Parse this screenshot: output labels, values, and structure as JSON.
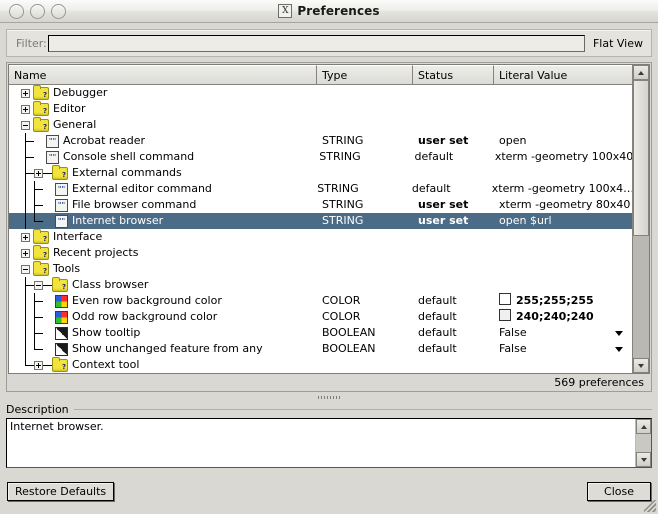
{
  "window": {
    "title": "Preferences",
    "logo_glyph": "X",
    "controls": [
      "close-button",
      "minimize-button",
      "zoom-button"
    ]
  },
  "filter_bar": {
    "label": "Filter:",
    "value": "",
    "placeholder": "",
    "flat_view_label": "Flat View"
  },
  "tree": {
    "columns": [
      "Name",
      "Type",
      "Status",
      "Literal Value"
    ],
    "status_text": "569 preferences",
    "selection_color": "#4b6b86",
    "rows": [
      {
        "name": "Debugger",
        "depth": 0,
        "kind": "folder",
        "expander": "plus",
        "type": "",
        "status": "",
        "literal": "",
        "selected": false
      },
      {
        "name": "Editor",
        "depth": 0,
        "kind": "folder",
        "expander": "plus",
        "type": "",
        "status": "",
        "literal": "",
        "selected": false
      },
      {
        "name": "General",
        "depth": 0,
        "kind": "folder",
        "expander": "minus",
        "type": "",
        "status": "",
        "literal": "",
        "selected": false
      },
      {
        "name": "Acrobat reader",
        "depth": 1,
        "kind": "string",
        "expander": "none",
        "type": "STRING",
        "status": "user set",
        "literal": "open",
        "selected": false
      },
      {
        "name": "Console shell command",
        "depth": 1,
        "kind": "string",
        "expander": "none",
        "type": "STRING",
        "status": "default",
        "literal": "xterm -geometry 100x40",
        "selected": false
      },
      {
        "name": "External commands",
        "depth": 1,
        "kind": "folder",
        "expander": "plus",
        "type": "",
        "status": "",
        "literal": "",
        "selected": false
      },
      {
        "name": "External editor command",
        "depth": 2,
        "kind": "string",
        "expander": "none",
        "type": "STRING",
        "status": "default",
        "literal": "xterm -geometry 100x4…",
        "selected": false
      },
      {
        "name": "File browser command",
        "depth": 2,
        "kind": "string",
        "expander": "none",
        "type": "STRING",
        "status": "user set",
        "literal": "xterm -geometry 80x40",
        "selected": false
      },
      {
        "name": "Internet browser",
        "depth": 2,
        "kind": "string",
        "expander": "none",
        "type": "STRING",
        "status": "user set",
        "literal": "open $url",
        "selected": true
      },
      {
        "name": "Interface",
        "depth": 0,
        "kind": "folder",
        "expander": "plus",
        "type": "",
        "status": "",
        "literal": "",
        "selected": false
      },
      {
        "name": "Recent projects",
        "depth": 0,
        "kind": "folder",
        "expander": "plus",
        "type": "",
        "status": "",
        "literal": "",
        "selected": false
      },
      {
        "name": "Tools",
        "depth": 0,
        "kind": "folder",
        "expander": "minus",
        "type": "",
        "status": "",
        "literal": "",
        "selected": false
      },
      {
        "name": "Class browser",
        "depth": 1,
        "kind": "folder",
        "expander": "minus",
        "type": "",
        "status": "",
        "literal": "",
        "selected": false
      },
      {
        "name": "Even row background color",
        "depth": 2,
        "kind": "color",
        "expander": "none",
        "type": "COLOR",
        "status": "default",
        "literal": "255;255;255",
        "swatch": "#ffffff",
        "selected": false
      },
      {
        "name": "Odd row background color",
        "depth": 2,
        "kind": "color",
        "expander": "none",
        "type": "COLOR",
        "status": "default",
        "literal": "240;240;240",
        "swatch": "#f0f0f0",
        "selected": false
      },
      {
        "name": "Show tooltip",
        "depth": 2,
        "kind": "bool",
        "expander": "none",
        "type": "BOOLEAN",
        "status": "default",
        "literal": "False",
        "dropdown": true,
        "selected": false
      },
      {
        "name": "Show unchanged feature from any",
        "depth": 2,
        "kind": "bool",
        "expander": "none",
        "type": "BOOLEAN",
        "status": "default",
        "literal": "False",
        "dropdown": true,
        "selected": false
      },
      {
        "name": "Context tool",
        "depth": 1,
        "kind": "folder",
        "expander": "plus",
        "type": "",
        "status": "",
        "literal": "",
        "selected": false
      }
    ]
  },
  "description": {
    "legend": "Description",
    "text": "Internet browser."
  },
  "footer": {
    "restore_defaults_label": "Restore Defaults",
    "close_label": "Close"
  }
}
